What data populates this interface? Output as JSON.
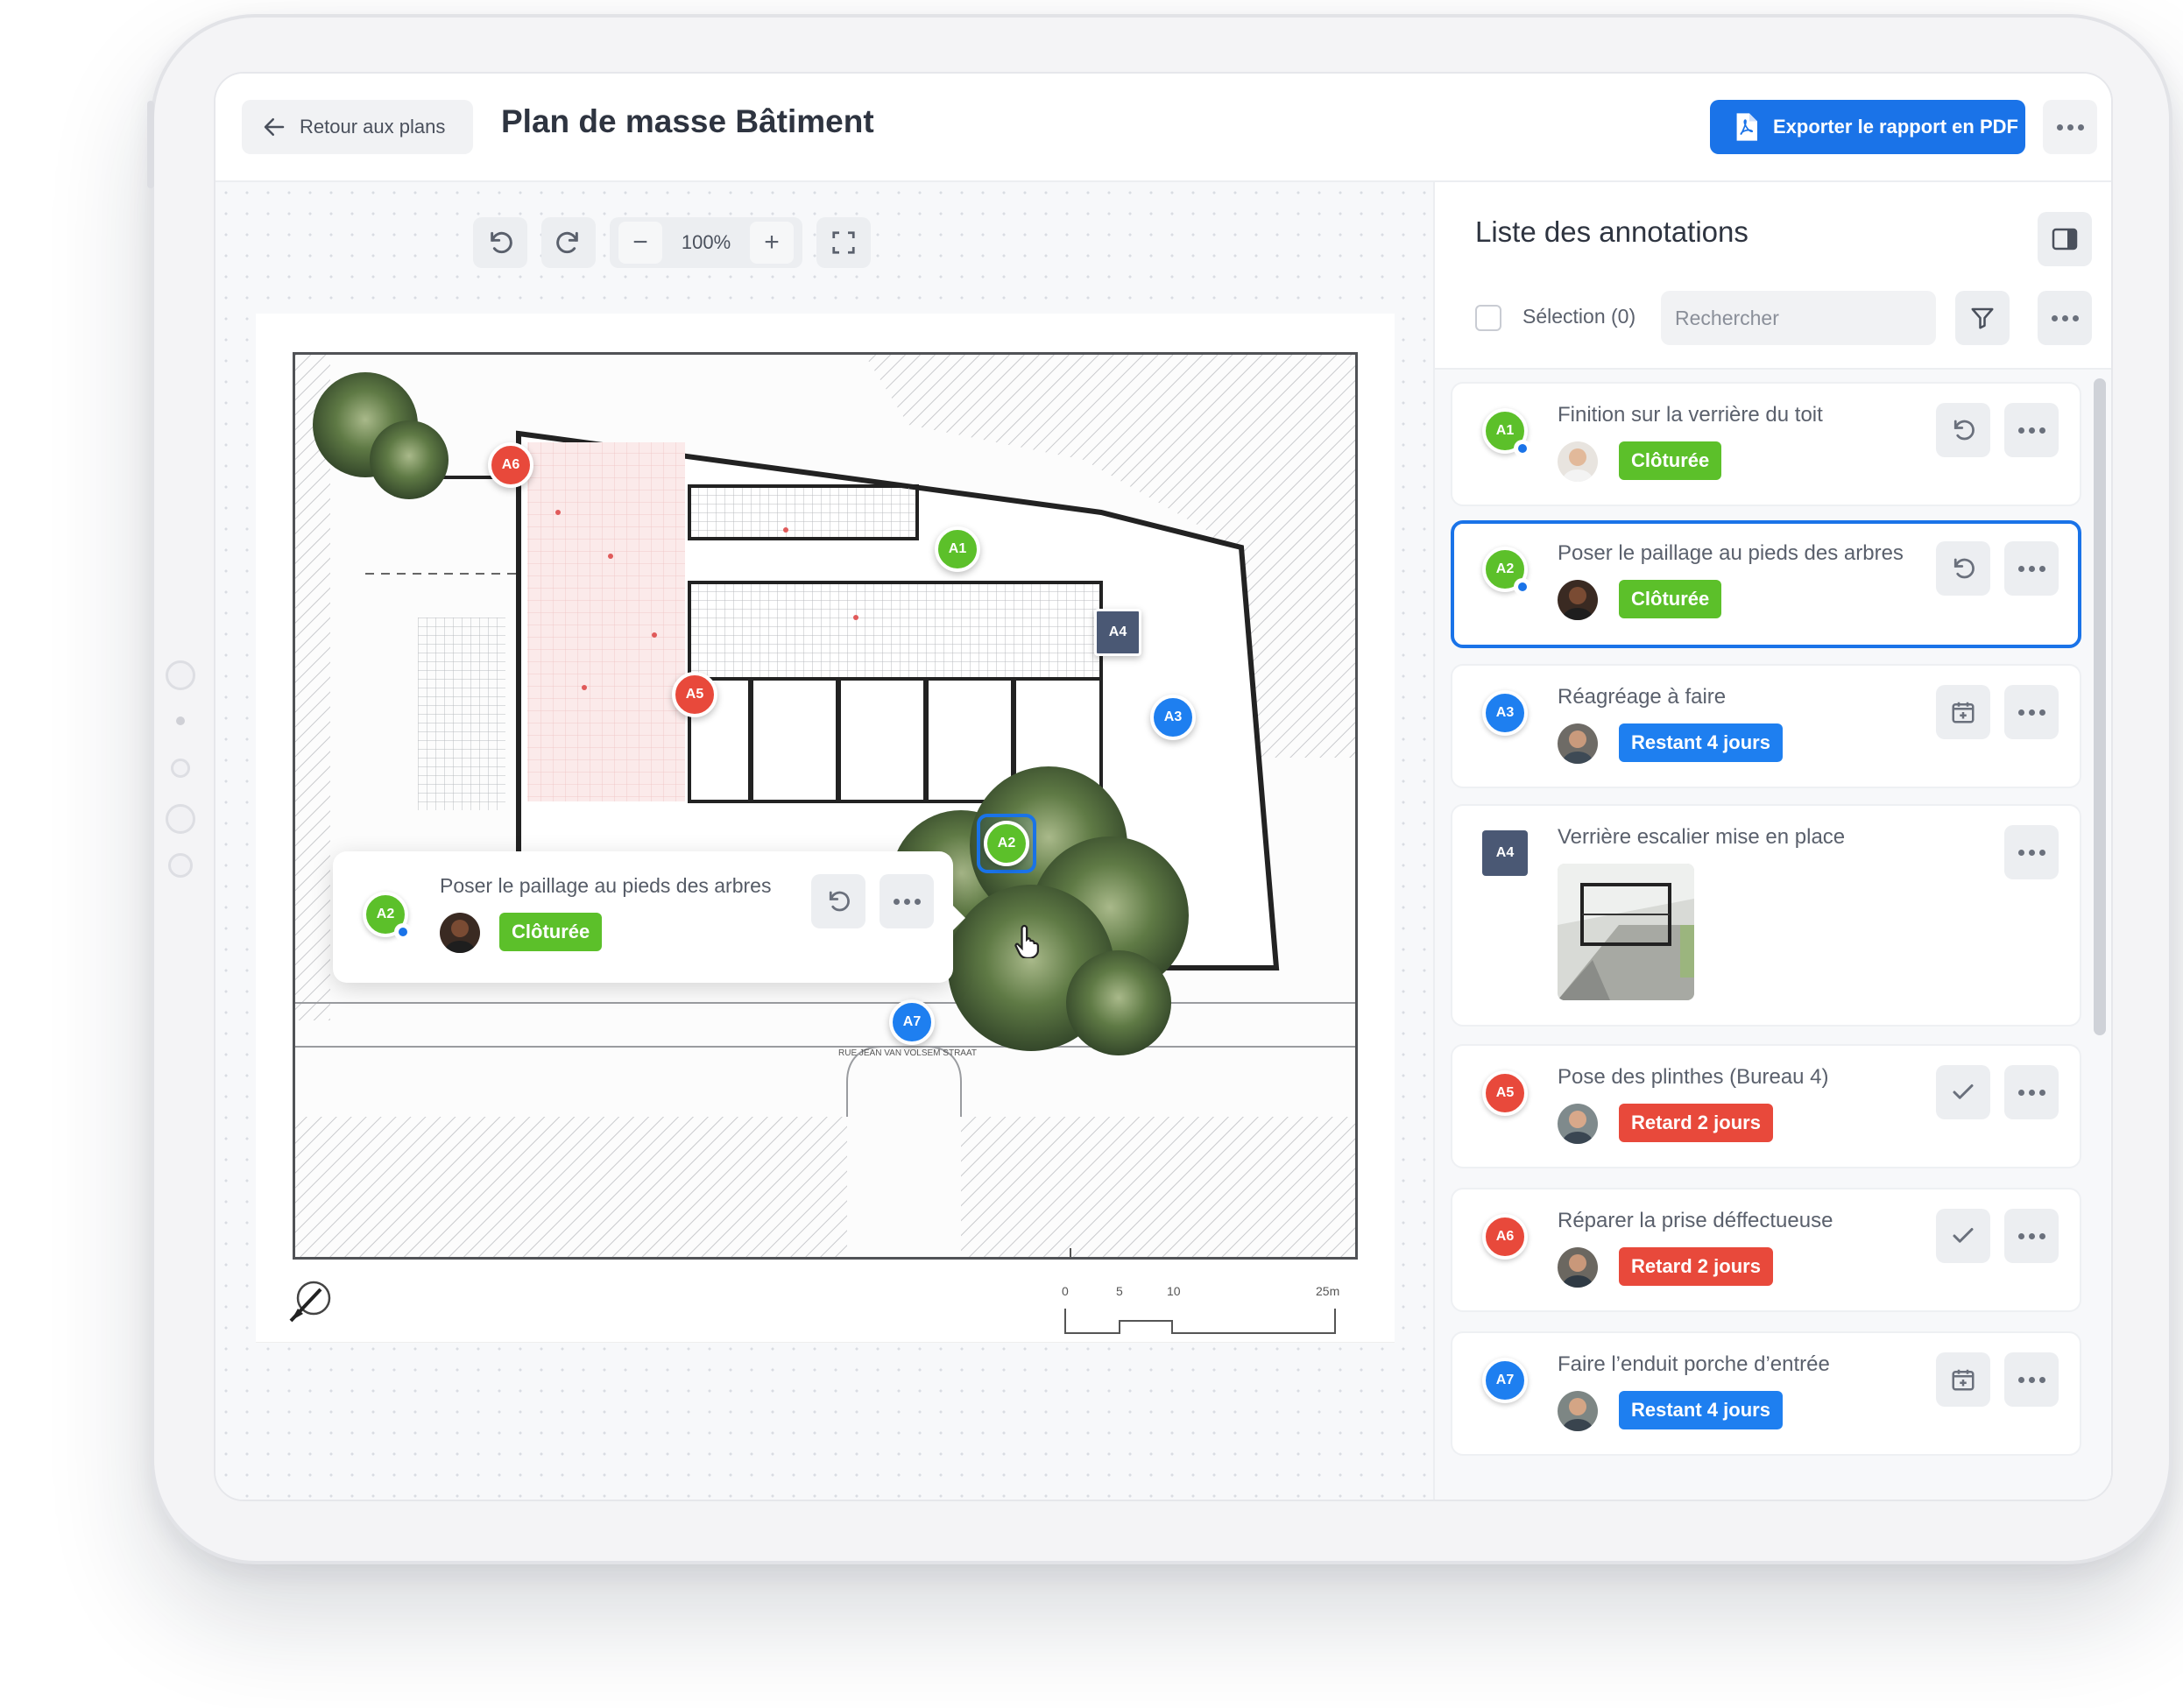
{
  "header": {
    "back_label": "Retour aux plans",
    "title": "Plan de masse Bâtiment",
    "export_label": "Exporter le rapport en PDF"
  },
  "toolbar": {
    "zoom": "100%"
  },
  "plan": {
    "markers": [
      {
        "id": "A6",
        "color": "red"
      },
      {
        "id": "A1",
        "color": "green"
      },
      {
        "id": "A4",
        "color": "navy"
      },
      {
        "id": "A5",
        "color": "red"
      },
      {
        "id": "A3",
        "color": "blue"
      },
      {
        "id": "A2",
        "color": "green"
      },
      {
        "id": "A7",
        "color": "blue"
      }
    ],
    "scale_labels": [
      "0",
      "5",
      "10",
      "25m"
    ],
    "street_label": "RUE JEAN VAN VOLSEM STRAAT"
  },
  "popup": {
    "marker": "A2",
    "title": "Poser le paillage au pieds des arbres",
    "status": "Clôturée"
  },
  "panel": {
    "title": "Liste des annotations",
    "selection_label": "Sélection (0)",
    "search_placeholder": "Rechercher",
    "items": [
      {
        "id": "A1",
        "title": "Finition sur la verrière du toit",
        "status": "Clôturée"
      },
      {
        "id": "A2",
        "title": "Poser le paillage au pieds des arbres",
        "status": "Clôturée"
      },
      {
        "id": "A3",
        "title": "Réagréage à faire",
        "status": "Restant 4 jours"
      },
      {
        "id": "A4",
        "title": "Verrière escalier mise en place"
      },
      {
        "id": "A5",
        "title": "Pose des plinthes (Bureau 4)",
        "status": "Retard 2 jours"
      },
      {
        "id": "A6",
        "title": "Réparer la prise déffectueuse",
        "status": "Retard 2 jours"
      },
      {
        "id": "A7",
        "title": "Faire l’enduit porche d’entrée",
        "status": "Restant 4 jours"
      }
    ]
  },
  "colors": {
    "accent": "#1a73e8",
    "green": "#5cc02a",
    "blue": "#1e7ff0",
    "red": "#e8493b",
    "navy": "#4a5874"
  }
}
